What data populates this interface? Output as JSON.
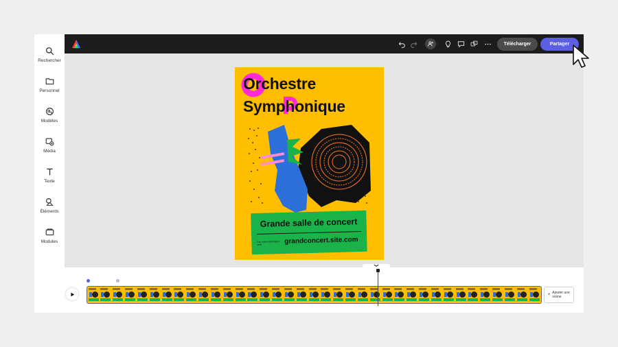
{
  "sidebar": {
    "items": [
      {
        "label": "Rechercher",
        "icon": "search-icon"
      },
      {
        "label": "Personnel",
        "icon": "folder-icon"
      },
      {
        "label": "Modèles",
        "icon": "templates-icon"
      },
      {
        "label": "Média",
        "icon": "media-icon"
      },
      {
        "label": "Texte",
        "icon": "text-icon"
      },
      {
        "label": "Éléments",
        "icon": "elements-icon"
      },
      {
        "label": "Modules",
        "icon": "modules-icon"
      }
    ]
  },
  "topbar": {
    "logo": "adobe-express-logo",
    "download_label": "Télécharger",
    "share_label": "Partager",
    "icons": [
      "undo-icon",
      "redo-icon",
      "add-user-icon",
      "lightbulb-icon",
      "comment-icon",
      "duplicate-icon",
      "more-icon"
    ]
  },
  "poster": {
    "title_line1": "Orchestre",
    "title_line2": "Symphonique",
    "venue": "Grande salle de concert",
    "small_text": "Sur notre information web",
    "url": "grandconcert.site.com",
    "colors": {
      "background": "#ffbf00",
      "accent": "#ff2bd6",
      "blue": "#2d6fd8",
      "green": "#19b34a",
      "orange": "#ff7a29",
      "black": "#111111"
    }
  },
  "timeline": {
    "add_scene_label": "Ajouter une scène",
    "scene_count": 37,
    "play_icon": "play-icon"
  }
}
